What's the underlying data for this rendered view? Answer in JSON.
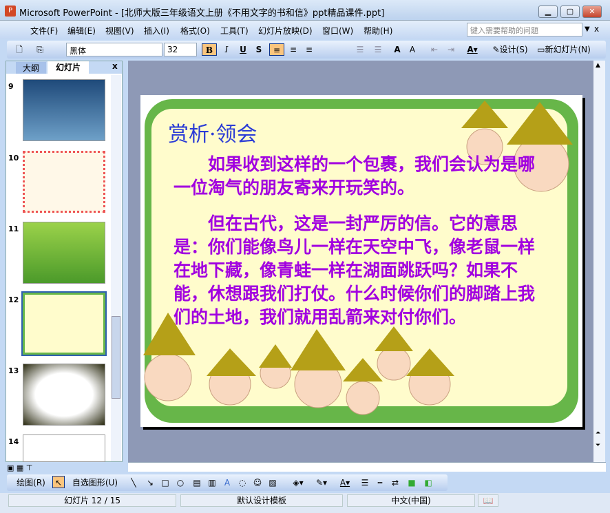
{
  "window": {
    "title": "Microsoft PowerPoint - [北师大版三年级语文上册《不用文字的书和信》ppt精品课件.ppt]",
    "app_icon": "powerpoint-icon"
  },
  "menu": [
    "文件(F)",
    "编辑(E)",
    "视图(V)",
    "插入(I)",
    "格式(O)",
    "工具(T)",
    "幻灯片放映(D)",
    "窗口(W)",
    "帮助(H)"
  ],
  "help_placeholder": "键入需要帮助的问题",
  "toolbar": {
    "font": "黑体",
    "size": "32",
    "bold": "B",
    "italic": "I",
    "underline": "U",
    "shadow": "S",
    "design": "设计(S)",
    "new_slide": "新幻灯片(N)"
  },
  "panel": {
    "tab_outline": "大纲",
    "tab_slides": "幻灯片",
    "close": "x"
  },
  "thumbnails": [
    {
      "num": "9"
    },
    {
      "num": "10"
    },
    {
      "num": "11"
    },
    {
      "num": "12"
    },
    {
      "num": "13"
    },
    {
      "num": "14"
    }
  ],
  "slide": {
    "title": "赏析·领会",
    "para1": "如果收到这样的一个包裹，我们会认为是哪一位淘气的朋友寄来开玩笑的。",
    "para2": "但在古代，这是一封严厉的信。它的意思是：你们能像鸟儿一样在天空中飞，像老鼠一样在地下藏，像青蛙一样在湖面跳跃吗？如果不能，休想跟我们打仗。什么时候你们的脚踏上我们的土地，我们就用乱箭来对付你们。"
  },
  "drawing": {
    "draw": "绘图(R)",
    "autoshapes": "自选图形(U)"
  },
  "status": {
    "slide": "幻灯片 12 / 15",
    "template": "默认设计模板",
    "language": "中文(中国)"
  },
  "colors": {
    "title": "#2a3bd6",
    "text": "#a100e0",
    "frame": "#67b649",
    "bg": "#fffccc"
  }
}
